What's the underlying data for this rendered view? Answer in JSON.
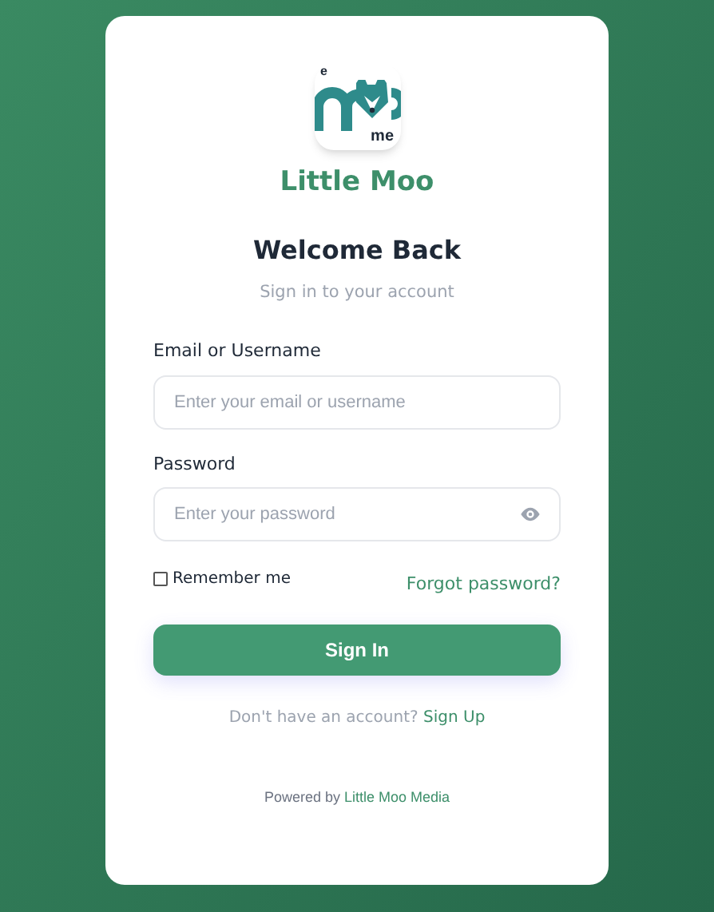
{
  "logo": {
    "texts": [
      "e",
      "me"
    ]
  },
  "brand": "Little Moo",
  "heading": "Welcome Back",
  "subheading": "Sign in to your account",
  "fields": [
    {
      "label": "Email or Username",
      "placeholder": "Enter your email or username",
      "kind": "text"
    },
    {
      "label": "Password",
      "placeholder": "Enter your password",
      "kind": "password"
    }
  ],
  "remember": {
    "label": "Remember me",
    "checked": false
  },
  "forgot_link": "Forgot password?",
  "submit_button": "Sign In",
  "signup": {
    "prompt": "Don't have an account?",
    "link": "Sign Up"
  },
  "footer": {
    "prefix": "Powered by",
    "link": "Little Moo Media"
  }
}
